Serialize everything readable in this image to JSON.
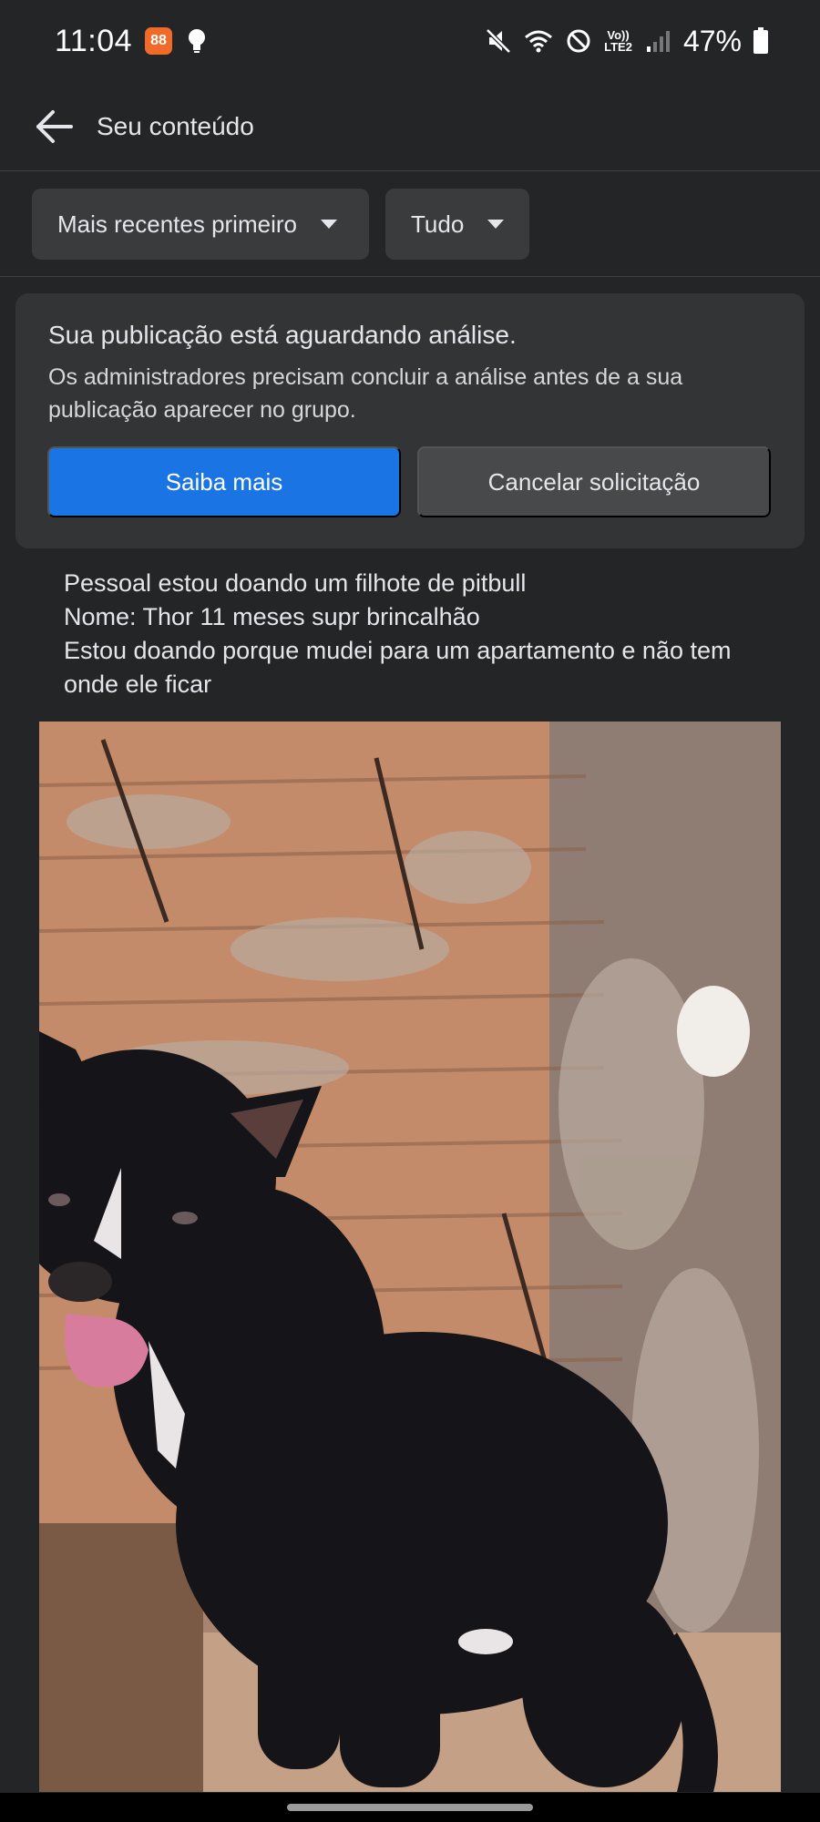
{
  "status_bar": {
    "time": "11:04",
    "app_badge": "88",
    "volte_top": "Vo))",
    "volte_bottom": "LTE2",
    "battery_percent": "47%"
  },
  "header": {
    "title": "Seu conteúdo"
  },
  "filters": {
    "sort_label": "Mais recentes primeiro",
    "type_label": "Tudo"
  },
  "pending_notice": {
    "title": "Sua publicação está aguardando análise.",
    "description": "Os administradores precisam concluir a análise antes de a sua publicação aparecer no grupo.",
    "learn_more_label": "Saiba mais",
    "cancel_label": "Cancelar solicitação"
  },
  "post": {
    "lines": [
      "Pessoal estou doando um filhote de pitbull",
      "Nome: Thor 11 meses supr brincalhão",
      "Estou doando porque mudei para um apartamento e não tem onde ele ficar"
    ]
  },
  "colors": {
    "background": "#242526",
    "primary_button": "#1b74e4",
    "card": "#323436"
  }
}
